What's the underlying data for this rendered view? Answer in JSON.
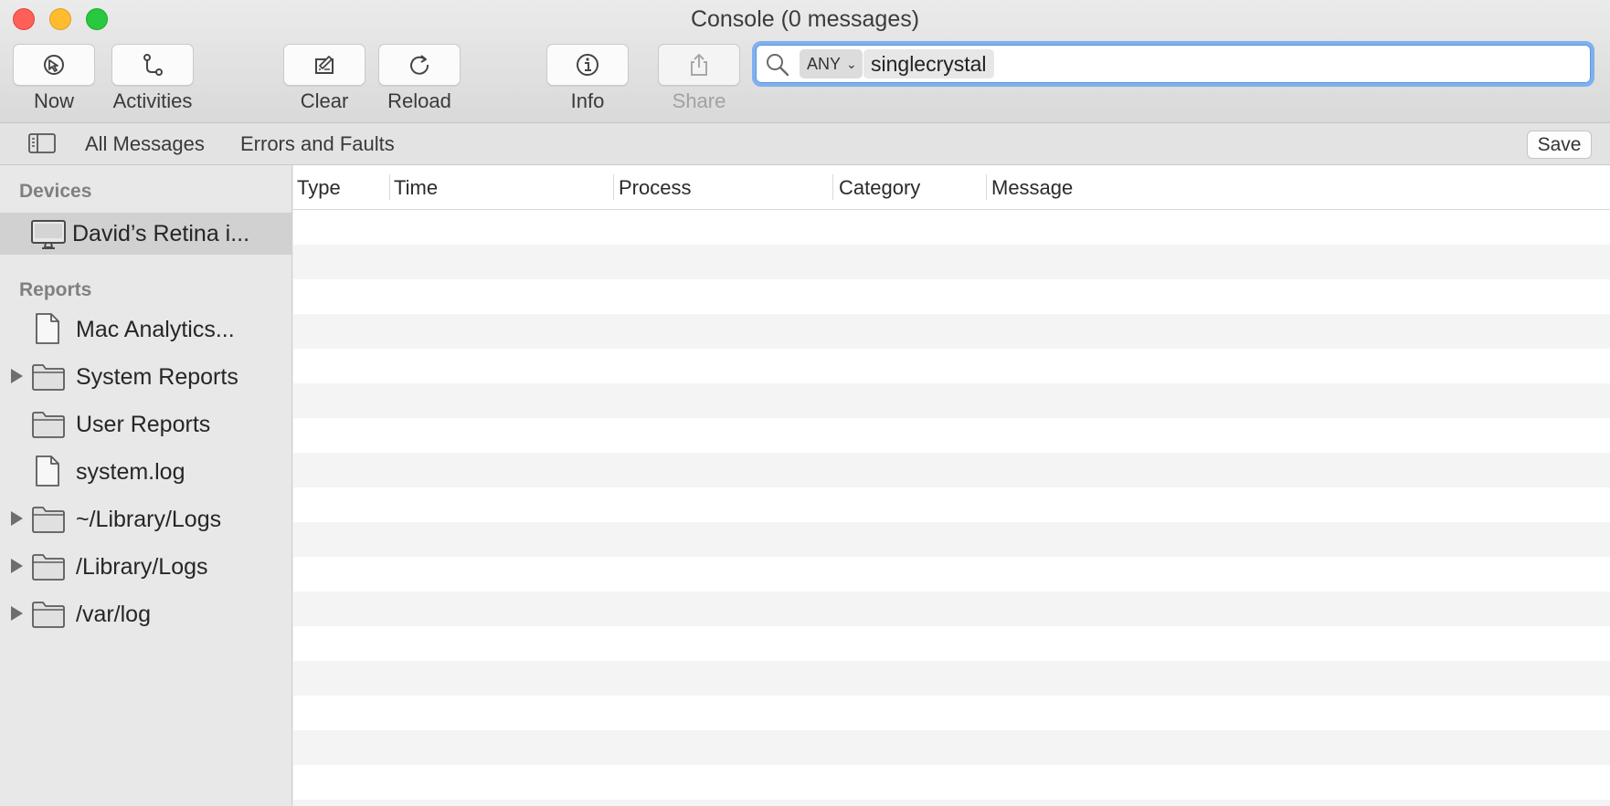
{
  "window": {
    "title": "Console (0 messages)"
  },
  "toolbar": {
    "now_label": "Now",
    "activities_label": "Activities",
    "clear_label": "Clear",
    "reload_label": "Reload",
    "info_label": "Info",
    "share_label": "Share"
  },
  "search": {
    "token_field": "ANY",
    "token_value": "singlecrystal",
    "icons": {
      "search": "magnifier-icon",
      "chevron": "chevron-down-icon"
    }
  },
  "filterbar": {
    "all_messages": "All Messages",
    "errors_faults": "Errors and Faults",
    "save_label": "Save"
  },
  "sidebar": {
    "devices_header": "Devices",
    "device": "David’s Retina i...",
    "reports_header": "Reports",
    "reports": [
      {
        "label": "Mac Analytics...",
        "icon": "document-icon",
        "expandable": false
      },
      {
        "label": "System Reports",
        "icon": "folder-icon",
        "expandable": true
      },
      {
        "label": "User Reports",
        "icon": "folder-icon",
        "expandable": false
      },
      {
        "label": "system.log",
        "icon": "document-icon",
        "expandable": false
      },
      {
        "label": "~/Library/Logs",
        "icon": "folder-icon",
        "expandable": true
      },
      {
        "label": "/Library/Logs",
        "icon": "folder-icon",
        "expandable": true
      },
      {
        "label": "/var/log",
        "icon": "folder-icon",
        "expandable": true
      }
    ]
  },
  "table": {
    "columns": [
      "Type",
      "Time",
      "Process",
      "Category",
      "Message"
    ],
    "rows": []
  },
  "colors": {
    "search_focus": "#7fb0ee",
    "selected_row": "#d1d1d1",
    "traffic_close": "#fe5f57",
    "traffic_min": "#febc2e",
    "traffic_max": "#28c840"
  }
}
